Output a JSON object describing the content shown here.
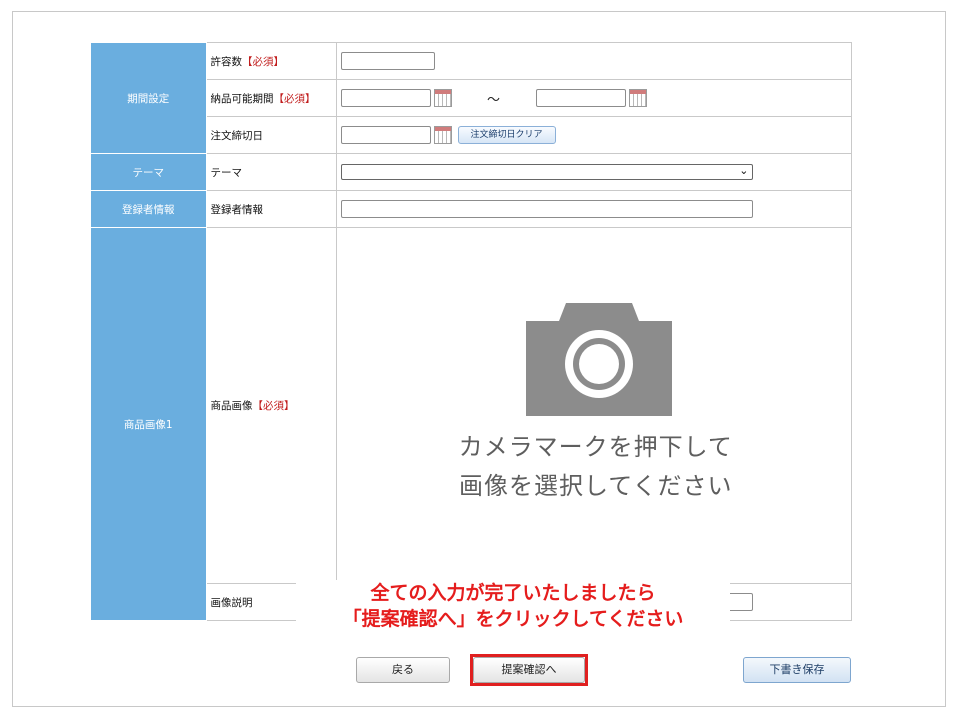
{
  "form": {
    "required_mark": "【必須】",
    "sections": {
      "period": "期間設定",
      "theme": "テーマ",
      "registrant": "登録者情報",
      "product_image": "商品画像1"
    },
    "fields": {
      "allowed_count": "許容数",
      "delivery_period": "納品可能期間",
      "order_deadline": "注文締切日",
      "theme": "テーマ",
      "registrant": "登録者情報",
      "product_image": "商品画像",
      "image_description": "画像説明"
    },
    "tilde": "～",
    "clear_deadline_button": "注文締切日クリア",
    "theme_select_value": "",
    "camera_caption_line1": "カメラマークを押下して",
    "camera_caption_line2": "画像を選択してください"
  },
  "annotation": {
    "line1": "全ての入力が完了いたしましたら",
    "line2": "「提案確認へ」をクリックしてください"
  },
  "buttons": {
    "back": "戻る",
    "confirm": "提案確認へ",
    "draft_save": "下書き保存"
  },
  "colors": {
    "section_header": "#6aaedf",
    "required": "#c11d1d",
    "annotation": "#e51d1d",
    "highlight_outline": "#e02020"
  }
}
